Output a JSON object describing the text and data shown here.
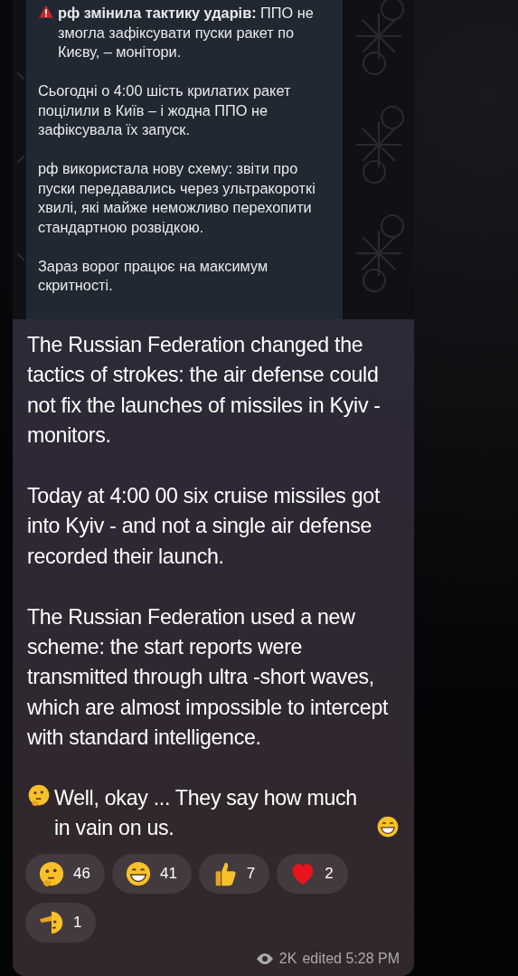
{
  "forwarded_screenshot": {
    "paragraphs": [
      {
        "kind": "alert",
        "text": "**рф змінила тактику ударів:** ППО не змогла зафіксувати пуски ракет по Києву, – монітори."
      },
      {
        "kind": "plain",
        "text": "Сьогодні о 4:00 шість крилатих ракет поцілили в Київ – і жодна ППО не зафіксувала їх запуск."
      },
      {
        "kind": "plain",
        "text": "рф використала нову схему: звіти про пуски передавались через ультракороткі хвилі, які майже неможливо перехопити стандартною розвідкою."
      },
      {
        "kind": "plain",
        "text": "Зараз ворог працює на максимум скритності."
      }
    ]
  },
  "message": {
    "paragraphs": [
      {
        "kind": "plain",
        "text": "The Russian Federation changed the tactics of strokes: the air defense could not fix the launches of missiles in Kyiv - monitors."
      },
      {
        "kind": "plain",
        "text": "Today at 4:00 00 six cruise missiles got into Kyiv - and not a single air defense recorded their launch."
      },
      {
        "kind": "plain",
        "text": "The Russian Federation used a new scheme: the start reports were transmitted through ultra -short waves, which are almost impossible to intercept with standard intelligence."
      },
      {
        "kind": "emoji",
        "text": "Well, okay ... They say how much in vain on us."
      }
    ],
    "reactions": [
      {
        "kind": "thinking",
        "count": "46"
      },
      {
        "kind": "grin",
        "count": "41"
      },
      {
        "kind": "thumbs",
        "count": "7"
      },
      {
        "kind": "heart",
        "count": "2"
      },
      {
        "kind": "salute",
        "count": "1"
      }
    ],
    "views": "2K",
    "edited": "edited 5:28 PM"
  }
}
